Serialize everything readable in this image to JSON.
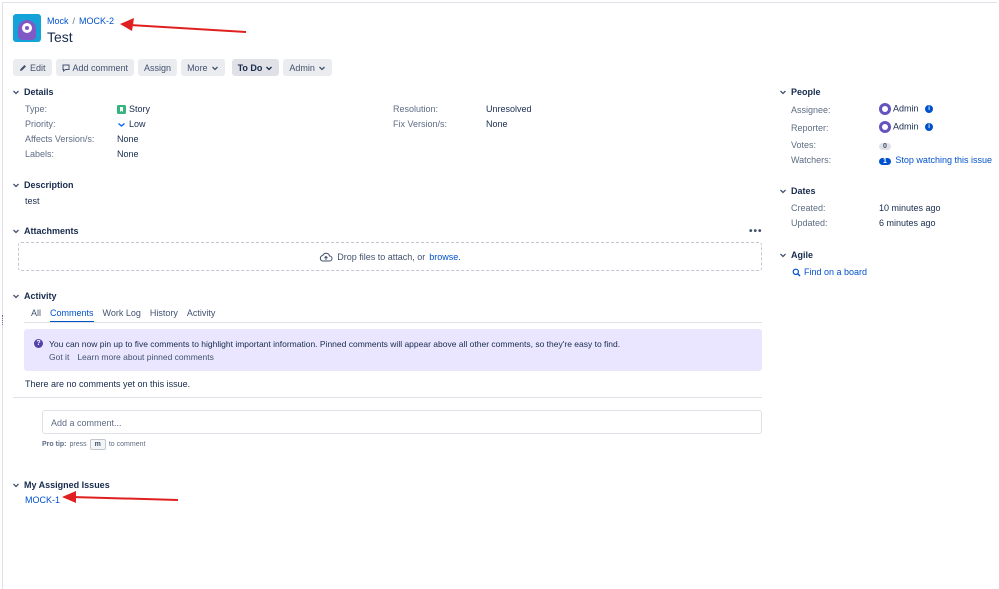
{
  "header": {
    "breadcrumb_project": "Mock",
    "breadcrumb_separator": "/",
    "breadcrumb_issue": "MOCK-2",
    "title": "Test",
    "project_avatar_icon": "project-avatar-icon"
  },
  "toolbar": {
    "edit": "Edit",
    "add_comment": "Add comment",
    "assign": "Assign",
    "more": "More",
    "status": "To Do",
    "admin": "Admin"
  },
  "details": {
    "heading": "Details",
    "type_label": "Type:",
    "type_value": "Story",
    "priority_label": "Priority:",
    "priority_value": "Low",
    "affects_label": "Affects Version/s:",
    "affects_value": "None",
    "labels_label": "Labels:",
    "labels_value": "None",
    "resolution_label": "Resolution:",
    "resolution_value": "Unresolved",
    "fix_label": "Fix Version/s:",
    "fix_value": "None"
  },
  "description": {
    "heading": "Description",
    "text": "test"
  },
  "attachments": {
    "heading": "Attachments",
    "more": "•••",
    "drop_text": "Drop files to attach, or",
    "browse": "browse."
  },
  "activity": {
    "heading": "Activity",
    "tabs": [
      "All",
      "Comments",
      "Work Log",
      "History",
      "Activity"
    ],
    "active_tab": "Comments",
    "notice_text": "You can now pin up to five comments to highlight important information. Pinned comments will appear above all other comments, so they're easy to find.",
    "notice_got_it": "Got it",
    "notice_learn_more": "Learn more about pinned comments",
    "no_comments": "There are no comments yet on this issue.",
    "comment_placeholder": "Add a comment...",
    "protip_bold": "Pro tip:",
    "protip_press": "press",
    "protip_key": "m",
    "protip_suffix": "to comment"
  },
  "assigned": {
    "heading": "My Assigned Issues",
    "item": "MOCK-1"
  },
  "people": {
    "heading": "People",
    "assignee_label": "Assignee:",
    "assignee_value": "Admin",
    "reporter_label": "Reporter:",
    "reporter_value": "Admin",
    "votes_label": "Votes:",
    "votes_value": "0",
    "watchers_label": "Watchers:",
    "watchers_count": "1",
    "watchers_action": "Stop watching this issue"
  },
  "dates": {
    "heading": "Dates",
    "created_label": "Created:",
    "created_value": "10 minutes ago",
    "updated_label": "Updated:",
    "updated_value": "6 minutes ago"
  },
  "agile": {
    "heading": "Agile",
    "find_on_board": "Find on a board"
  },
  "colors": {
    "link": "#0052cc",
    "arrow": "#e02020",
    "notice_bg": "#eae6ff",
    "story_green": "#36b37e"
  }
}
